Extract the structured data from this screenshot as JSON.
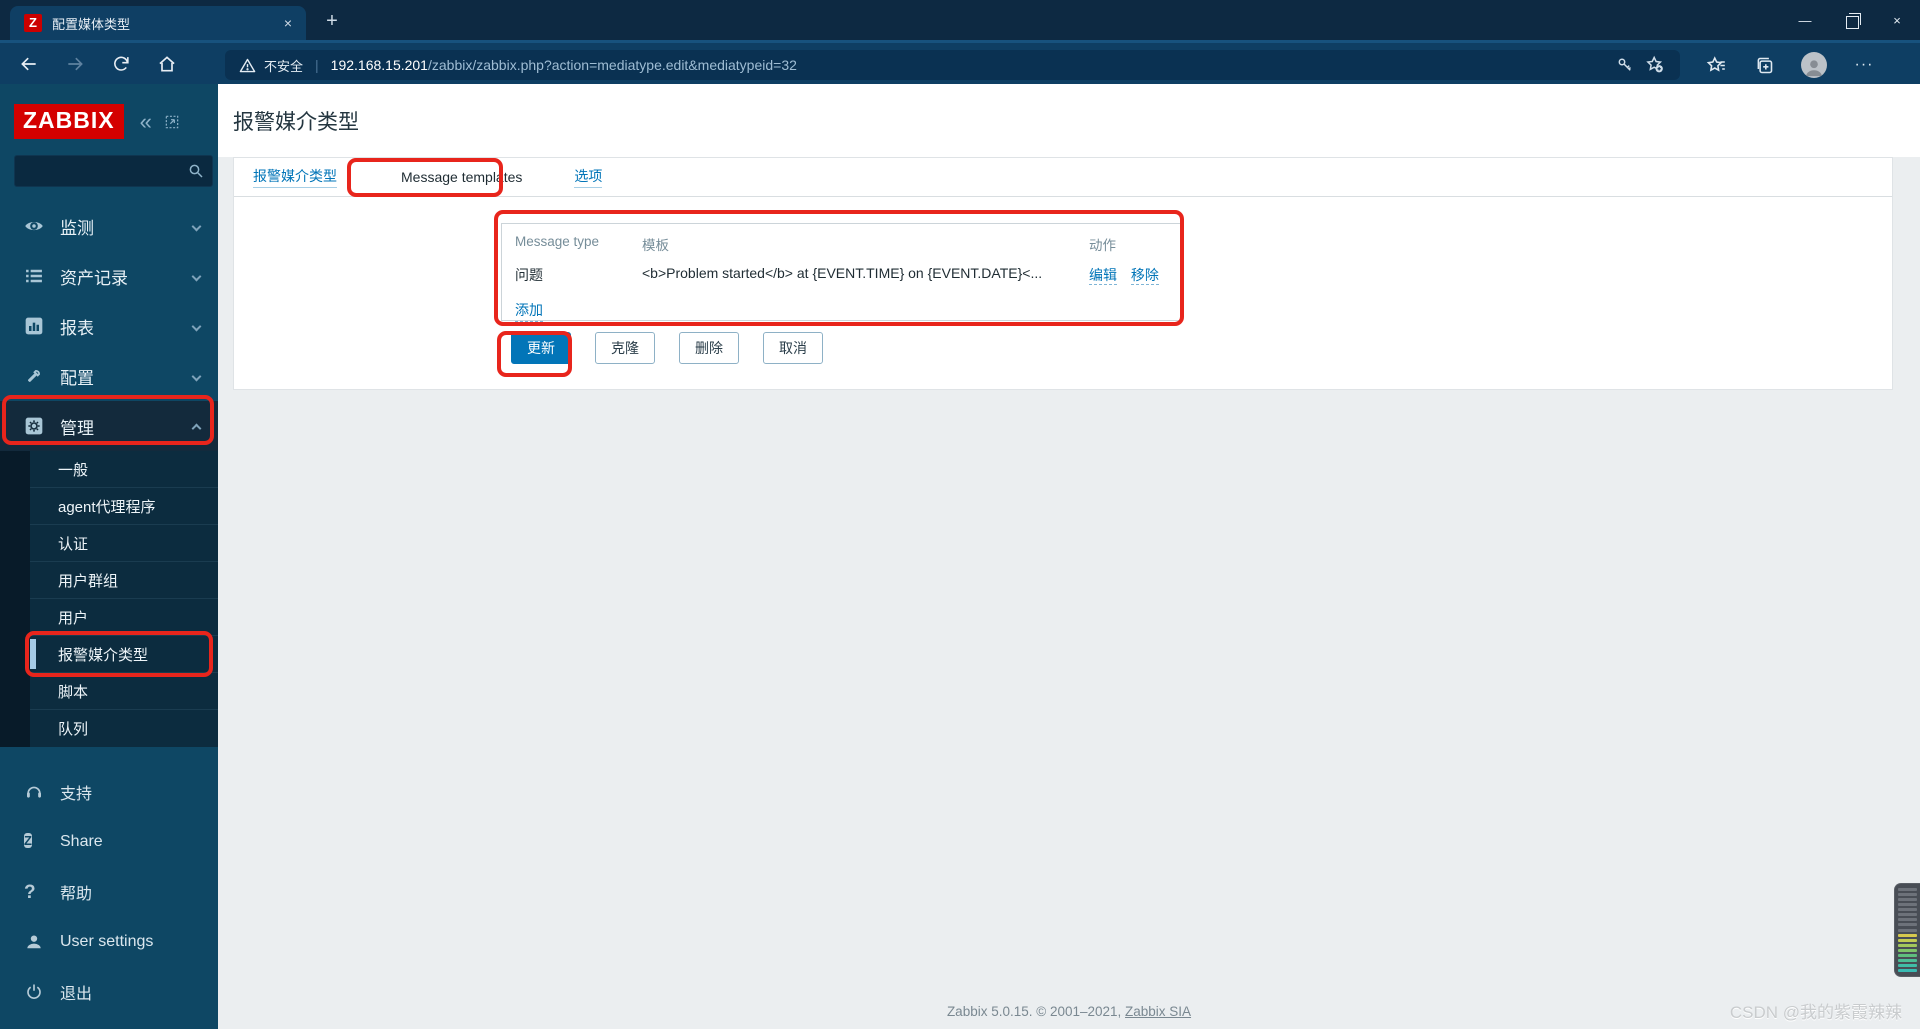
{
  "glyphs": {
    "favicon_letter": "Z",
    "new_tab": "+",
    "minimize": "—",
    "close": "×",
    "ellipsis": "···",
    "collapse": "«",
    "divider": "|",
    "share_letter": "Z",
    "help": "?"
  },
  "browser": {
    "tab_title": "配置媒体类型",
    "security_label": "不安全",
    "url_host": "192.168.15.201",
    "url_path": "/zabbix/zabbix.php?action=mediatype.edit&mediatypeid=32"
  },
  "sidebar": {
    "logo": "ZABBIX",
    "menu": [
      {
        "label": "监测"
      },
      {
        "label": "资产记录"
      },
      {
        "label": "报表"
      },
      {
        "label": "配置"
      },
      {
        "label": "管理",
        "active": true
      }
    ],
    "submenu": [
      {
        "label": "一般"
      },
      {
        "label": "agent代理程序"
      },
      {
        "label": "认证"
      },
      {
        "label": "用户群组"
      },
      {
        "label": "用户"
      },
      {
        "label": "报警媒介类型",
        "selected": true
      },
      {
        "label": "脚本"
      },
      {
        "label": "队列"
      }
    ],
    "footer_menu": [
      {
        "label": "支持"
      },
      {
        "label": "Share"
      },
      {
        "label": "帮助"
      },
      {
        "label": "User settings"
      },
      {
        "label": "退出"
      }
    ]
  },
  "page": {
    "title": "报警媒介类型",
    "tabs": [
      {
        "label": "报警媒介类型"
      },
      {
        "label": "Message templates",
        "active": true
      },
      {
        "label": "选项"
      }
    ],
    "table": {
      "col_message_type": "Message type",
      "col_template": "模板",
      "col_action": "动作",
      "row_type": "问题",
      "row_template": "<b>Problem started</b> at {EVENT.TIME} on {EVENT.DATE}<...",
      "action_edit": "编辑",
      "action_remove": "移除",
      "add_link": "添加"
    },
    "buttons": {
      "update": "更新",
      "clone": "克隆",
      "delete": "删除",
      "cancel": "取消"
    },
    "footer_text": "Zabbix 5.0.15. © 2001–2021, ",
    "footer_link": "Zabbix SIA",
    "watermark": "CSDN @我的紫霞辣辣"
  },
  "colors": {
    "accent_blue": "#0275b8",
    "annotation_red": "#e8251c",
    "sidebar_bg": "#0e4764",
    "logo_red": "#d40000"
  }
}
